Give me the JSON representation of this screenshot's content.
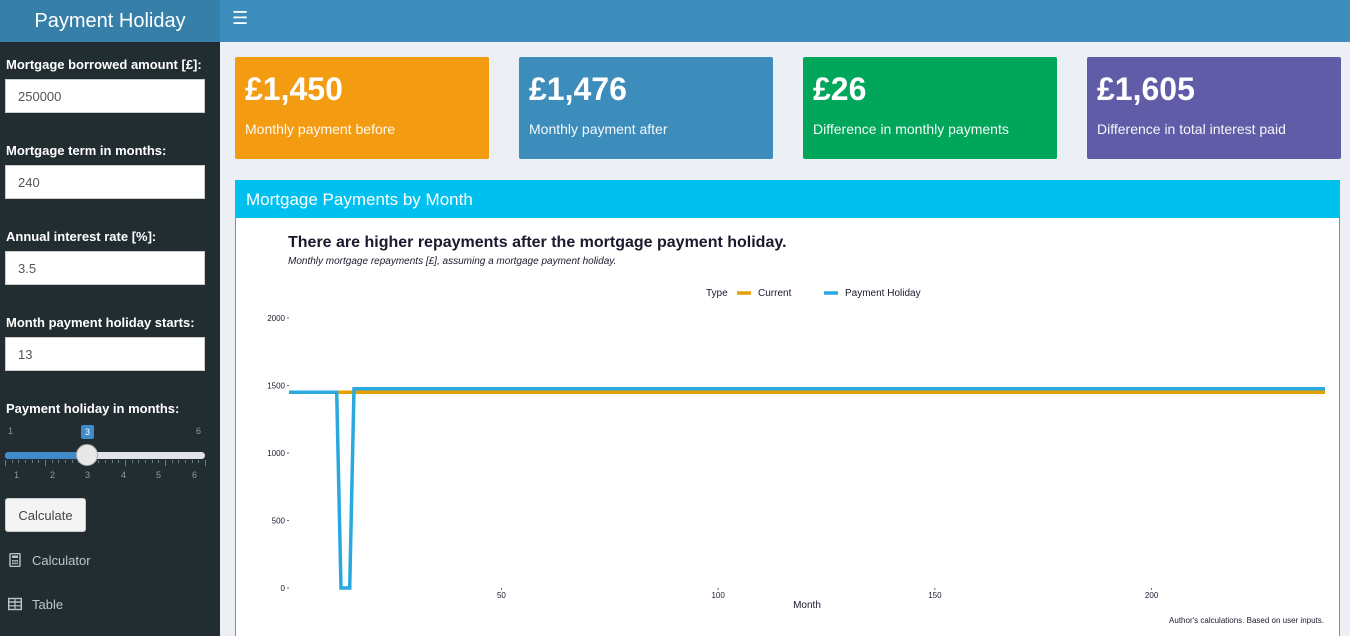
{
  "app": {
    "title": "Payment Holiday",
    "menu_icon": "hamburger-icon"
  },
  "sidebar": {
    "mortgage_amount": {
      "label": "Mortgage borrowed amount [£]:",
      "value": "250000"
    },
    "term": {
      "label": "Mortgage term in months:",
      "value": "240"
    },
    "rate": {
      "label": "Annual interest rate [%]:",
      "value": "3.5"
    },
    "holiday_start": {
      "label": "Month payment holiday starts:",
      "value": "13"
    },
    "holiday_months": {
      "label": "Payment holiday in months:",
      "min": "1",
      "max": "6",
      "value": "3",
      "tick_labels": [
        "1",
        "2",
        "3",
        "4",
        "5",
        "6"
      ]
    },
    "calculate_label": "Calculate",
    "menu": [
      {
        "label": "Calculator",
        "icon": "calculator-icon"
      },
      {
        "label": "Table",
        "icon": "table-icon"
      }
    ]
  },
  "value_boxes": [
    {
      "value": "£1,450",
      "subtitle": "Monthly payment before",
      "color": "#f39c12"
    },
    {
      "value": "£1,476",
      "subtitle": "Monthly payment after",
      "color": "#3c8dbc"
    },
    {
      "value": "£26",
      "subtitle": "Difference in monthly payments",
      "color": "#00a65a"
    },
    {
      "value": "£1,605",
      "subtitle": "Difference in total interest paid",
      "color": "#605ca8"
    }
  ],
  "chart_box": {
    "header": "Mortgage Payments by Month"
  },
  "chart_data": {
    "type": "line",
    "title": "There are higher repayments after the mortgage payment holiday.",
    "subtitle": "Monthly mortgage repayments [£], assuming a mortgage payment holiday.",
    "caption": "Author's calculations. Based on user inputs.",
    "xlabel": "Month",
    "ylabel": "",
    "xlim": [
      1,
      240
    ],
    "ylim": [
      0,
      2000
    ],
    "x_ticks": [
      50,
      100,
      150,
      200
    ],
    "y_ticks": [
      0,
      500,
      1000,
      1500,
      2000
    ],
    "legend": {
      "title": "Type",
      "position": "top"
    },
    "series": [
      {
        "name": "Current",
        "color": "#e69f00",
        "points": [
          [
            1,
            1450
          ],
          [
            240,
            1450
          ]
        ]
      },
      {
        "name": "Payment Holiday",
        "color": "#29a9e0",
        "points": [
          [
            1,
            1450
          ],
          [
            12,
            1450
          ],
          [
            13,
            0
          ],
          [
            15,
            0
          ],
          [
            16,
            1476
          ],
          [
            240,
            1476
          ]
        ]
      }
    ]
  }
}
